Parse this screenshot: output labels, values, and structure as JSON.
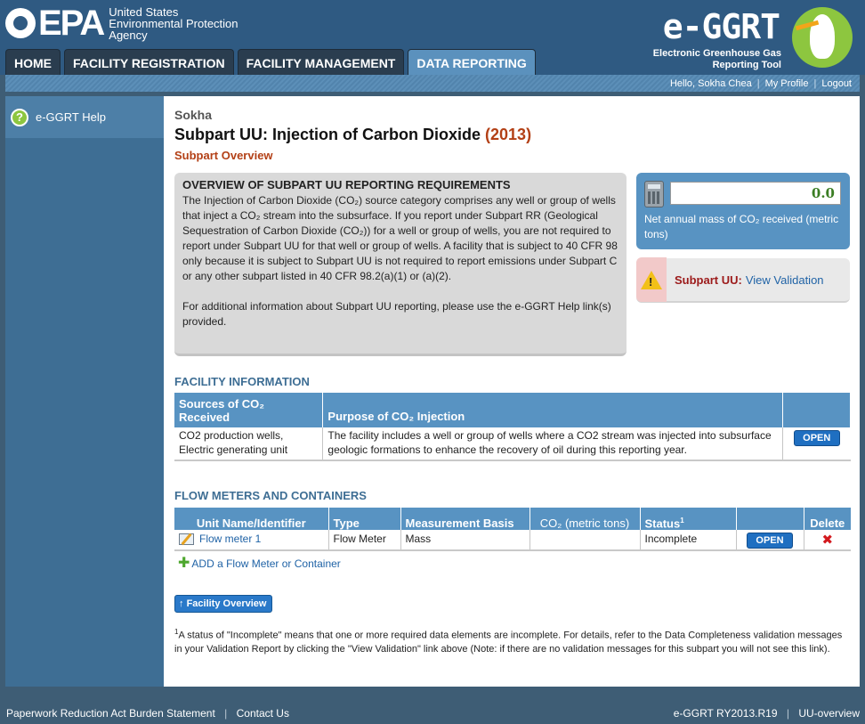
{
  "header": {
    "epa_text": "EPA",
    "agency": [
      "United States",
      "Environmental Protection",
      "Agency"
    ],
    "app_title": "e-GGRT",
    "app_subtitle": [
      "Electronic Greenhouse Gas",
      "Reporting Tool"
    ]
  },
  "nav": {
    "tabs": [
      {
        "label": "HOME",
        "active": false
      },
      {
        "label": "FACILITY REGISTRATION",
        "active": false
      },
      {
        "label": "FACILITY MANAGEMENT",
        "active": false
      },
      {
        "label": "DATA REPORTING",
        "active": true
      }
    ]
  },
  "userbar": {
    "greeting": "Hello, Sokha Chea",
    "my_profile": "My Profile",
    "logout": "Logout"
  },
  "sidebar": {
    "help_label": "e-GGRT Help"
  },
  "page": {
    "facility": "Sokha",
    "title": "Subpart UU: Injection of Carbon Dioxide",
    "year": "(2013)",
    "sub_heading": "Subpart Overview"
  },
  "overview": {
    "heading": "OVERVIEW OF SUBPART UU REPORTING REQUIREMENTS",
    "para1": "The Injection of Carbon Dioxide (CO₂) source category comprises any well or group of wells that inject a CO₂ stream into the subsurface. If you report under Subpart RR (Geological Sequestration of Carbon Dioxide (CO₂)) for a well or group of wells, you are not required to report under Subpart UU for that well or group of wells. A facility that is subject to 40 CFR 98 only because it is subject to Subpart UU is not required to report emissions under Subpart C or any other subpart listed in 40 CFR 98.2(a)(1) or (a)(2).",
    "para2": "For additional information about Subpart UU reporting, please use the e-GGRT Help link(s) provided."
  },
  "mass_box": {
    "value": "0.0",
    "label": "Net annual mass of CO₂ received (metric tons)"
  },
  "validation": {
    "label": "Subpart UU:",
    "link": "View Validation"
  },
  "facility_info": {
    "title": "FACILITY INFORMATION",
    "col_sources": "Sources of CO₂ Received",
    "col_purpose": "Purpose of CO₂ Injection",
    "row": {
      "sources": "CO2 production wells, Electric generating unit",
      "purpose": "The facility includes a well or group of wells where a CO2 stream was injected into subsurface geologic formations to enhance the recovery of oil during this reporting year.",
      "button": "OPEN"
    }
  },
  "flow_meters": {
    "title": "FLOW METERS AND CONTAINERS",
    "columns": {
      "unit": "Unit Name/Identifier",
      "type": "Type",
      "basis": "Measurement Basis",
      "co2": "CO₂ (metric tons)",
      "status": "Status",
      "status_sup": "1",
      "delete": "Delete"
    },
    "rows": [
      {
        "unit": "Flow meter 1",
        "type": "Flow Meter",
        "basis": "Mass",
        "co2": "",
        "status": "Incomplete",
        "button": "OPEN"
      }
    ],
    "add_link": "ADD a Flow Meter or Container"
  },
  "facility_overview_btn": "Facility Overview",
  "footnote": {
    "sup": "1",
    "text": "A status of \"Incomplete\" means that one or more required data elements are incomplete. For details, refer to the Data Completeness validation messages in your Validation Report by clicking the \"View Validation\" link above (Note: if there are no validation messages for this subpart you will not see this link)."
  },
  "footer": {
    "paperwork": "Paperwork Reduction Act Burden Statement",
    "contact": "Contact Us",
    "version": "e-GGRT RY2013.R19",
    "page_id": "UU-overview"
  }
}
